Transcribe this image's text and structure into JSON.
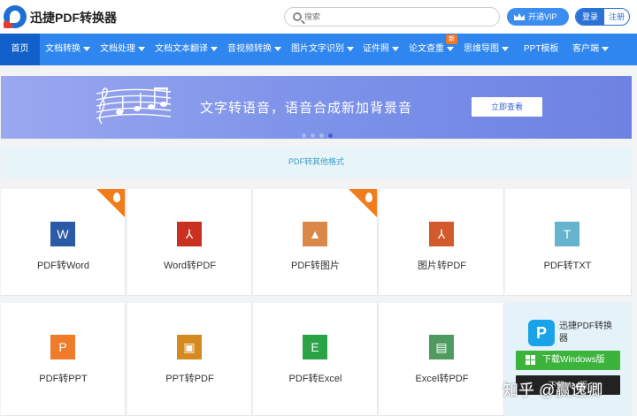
{
  "header": {
    "brand": "迅捷PDF转换器",
    "search_placeholder": "搜索",
    "vip_label": "开通VIP",
    "login_label": "登录",
    "register_label": "注册"
  },
  "nav": {
    "items": [
      {
        "label": "首页",
        "caret": false
      },
      {
        "label": "文档转换",
        "caret": true
      },
      {
        "label": "文档处理",
        "caret": true
      },
      {
        "label": "文档文本翻译",
        "caret": true
      },
      {
        "label": "音视频转换",
        "caret": true
      },
      {
        "label": "图片文字识别",
        "caret": true
      },
      {
        "label": "证件照",
        "caret": true
      },
      {
        "label": "论文查重",
        "caret": true
      },
      {
        "label": "思维导图",
        "caret": true
      },
      {
        "label": "PPT模板",
        "caret": false
      },
      {
        "label": "客户端",
        "caret": true
      }
    ],
    "new_badge": "新"
  },
  "banner": {
    "text": "文字转语音，语音合成新加背景音",
    "button": "立即查看",
    "slide_count": 4,
    "active_slide": 4
  },
  "formats_link": "PDF转其他格式",
  "tools": [
    {
      "label": "PDF转Word",
      "tile_text": "W",
      "color": "#2b5aa6",
      "hot": true
    },
    {
      "label": "Word转PDF",
      "tile_text": "⅄",
      "color": "#c9301f",
      "hot": false
    },
    {
      "label": "PDF转图片",
      "tile_text": "▲",
      "color": "#d9884a",
      "hot": true
    },
    {
      "label": "图片转PDF",
      "tile_text": "⅄",
      "color": "#d25a2c",
      "hot": false
    },
    {
      "label": "PDF转TXT",
      "tile_text": "T",
      "color": "#63b4cc",
      "hot": false
    },
    {
      "label": "PDF转PPT",
      "tile_text": "P",
      "color": "#ee7c2a",
      "hot": false
    },
    {
      "label": "PPT转PDF",
      "tile_text": "▣",
      "color": "#d48a1f",
      "hot": false
    },
    {
      "label": "PDF转Excel",
      "tile_text": "E",
      "color": "#2aa347",
      "hot": false
    },
    {
      "label": "Excel转PDF",
      "tile_text": "▤",
      "color": "#4f9a5f",
      "hot": false
    }
  ],
  "promo": {
    "logo_text": "P",
    "title": "迅捷PDF转换器",
    "download_windows": "下载Windows版",
    "download_other": "下载Mac版"
  },
  "watermark": "知乎 @赢逸卿"
}
